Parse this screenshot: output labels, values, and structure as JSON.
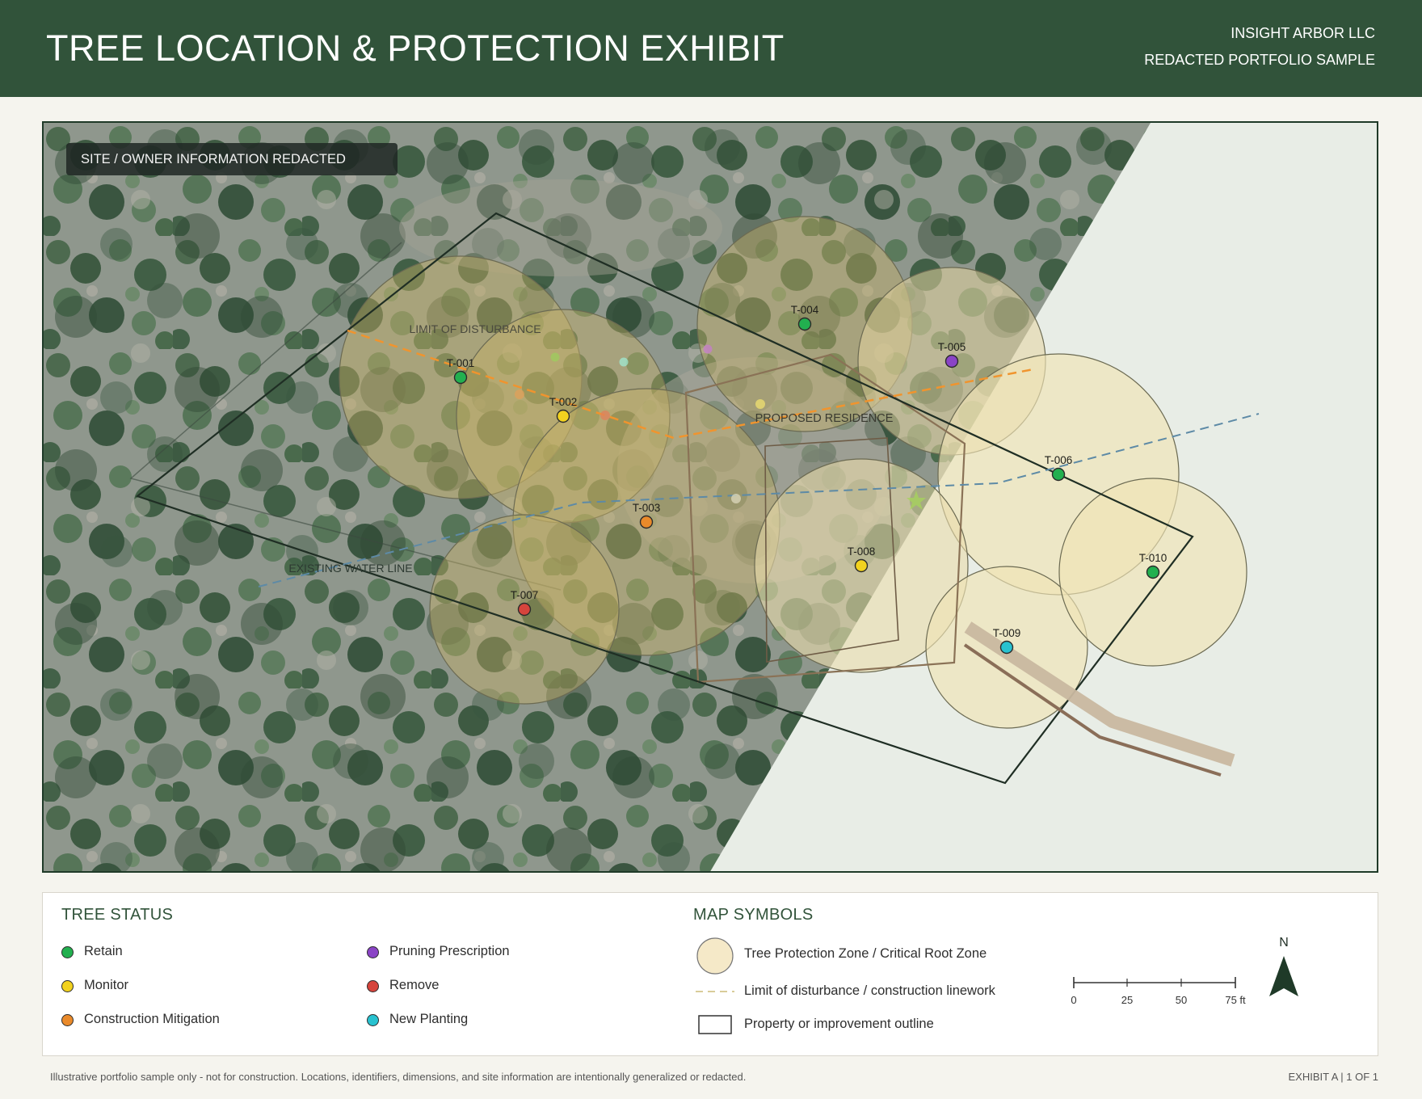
{
  "header": {
    "title": "TREE LOCATION & PROTECTION EXHIBIT",
    "company": "INSIGHT ARBOR LLC",
    "subtitle": "REDACTED PORTFOLIO SAMPLE",
    "background_color": "#31533a"
  },
  "map": {
    "redacted_badge": "SITE / OWNER INFORMATION REDACTED",
    "labels": {
      "limit_of_disturbance": "LIMIT OF DISTURBANCE",
      "proposed_residence": "PROPOSED RESIDENCE",
      "existing_water_line": "EXISTING WATER LINE"
    },
    "trees": [
      {
        "id": "T-001",
        "status": "Retain"
      },
      {
        "id": "T-002",
        "status": "Monitor"
      },
      {
        "id": "T-003",
        "status": "Construction Mitigation"
      },
      {
        "id": "T-004",
        "status": "Retain"
      },
      {
        "id": "T-005",
        "status": "Pruning Prescription"
      },
      {
        "id": "T-006",
        "status": "Retain"
      },
      {
        "id": "T-007",
        "status": "Remove"
      },
      {
        "id": "T-008",
        "status": "Monitor"
      },
      {
        "id": "T-009",
        "status": "New Planting"
      },
      {
        "id": "T-010",
        "status": "Retain"
      }
    ]
  },
  "legend": {
    "tree_status_heading": "TREE STATUS",
    "statuses": [
      {
        "label": "Retain",
        "color": "#22b04f"
      },
      {
        "label": "Monitor",
        "color": "#f2d21f"
      },
      {
        "label": "Construction Mitigation",
        "color": "#ea8a2a"
      },
      {
        "label": "Pruning Prescription",
        "color": "#8a44c6"
      },
      {
        "label": "Remove",
        "color": "#d6443c"
      },
      {
        "label": "New Planting",
        "color": "#28c2d0"
      }
    ],
    "map_symbols_heading": "MAP SYMBOLS",
    "symbols": {
      "tpz": "Tree Protection Zone / Critical Root Zone",
      "lod": "Limit of disturbance / construction linework",
      "outline": "Property or improvement outline"
    },
    "scale": {
      "ticks": [
        "0",
        "25",
        "50",
        "75 ft"
      ]
    },
    "north": "N"
  },
  "footer": {
    "note": "Illustrative portfolio sample only - not for construction. Locations, identifiers, dimensions, and site information are intentionally generalized or redacted.",
    "exhibit": "EXHIBIT A  |  1 OF 1"
  }
}
